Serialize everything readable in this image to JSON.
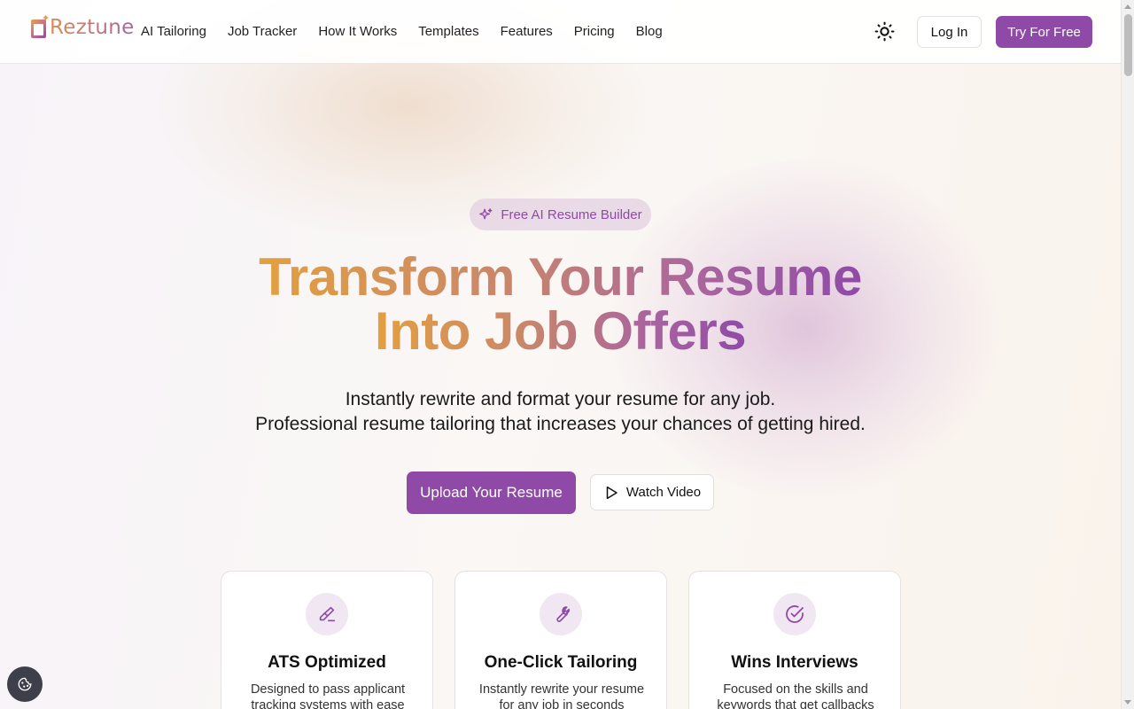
{
  "brand": {
    "name": "Reztune"
  },
  "nav": {
    "items": [
      {
        "label": "AI Tailoring"
      },
      {
        "label": "Job Tracker"
      },
      {
        "label": "How It Works"
      },
      {
        "label": "Templates"
      },
      {
        "label": "Features"
      },
      {
        "label": "Pricing"
      },
      {
        "label": "Blog"
      }
    ],
    "login_label": "Log In",
    "try_label": "Try For Free",
    "theme_icon": "sun-icon"
  },
  "hero": {
    "badge": "Free AI Resume Builder",
    "headline_line1": "Transform Your Resume",
    "headline_line2": "Into Job Offers",
    "subtitle_line1": "Instantly rewrite and format your resume for any job.",
    "subtitle_line2": "Professional resume tailoring that increases your chances of getting hired.",
    "upload_label": "Upload Your Resume",
    "watch_label": "Watch Video"
  },
  "features": [
    {
      "icon": "highlighter-icon",
      "title": "ATS Optimized",
      "desc": "Designed to pass applicant tracking systems with ease"
    },
    {
      "icon": "wrench-icon",
      "title": "One-Click Tailoring",
      "desc": "Instantly rewrite your resume for any job in seconds"
    },
    {
      "icon": "check-circle-icon",
      "title": "Wins Interviews",
      "desc": "Focused on the skills and keywords that get callbacks"
    }
  ],
  "colors": {
    "accent": "#8e4aa6",
    "gradient_start": "#e3a040",
    "gradient_end": "#8e4aa6"
  }
}
